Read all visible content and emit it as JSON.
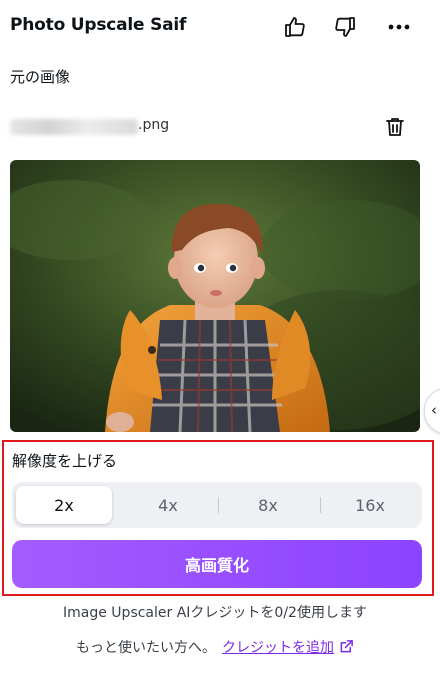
{
  "header": {
    "title": "Photo Upscale Saif",
    "thumbs_up_icon": "thumbs-up-icon",
    "thumbs_down_icon": "thumbs-down-icon",
    "more_icon": "more-horizontal-icon"
  },
  "original": {
    "label": "元の画像",
    "file_extension": ".png",
    "delete_icon": "trash-icon"
  },
  "upscale": {
    "label": "解像度を上げる",
    "options": [
      "2x",
      "4x",
      "8x",
      "16x"
    ],
    "selected": "2x",
    "button_label": "高画質化"
  },
  "footer": {
    "credit_note": "Image Upscaler AIクレジットを0/2使用します",
    "more_text": "もっと使いたい方へ。",
    "add_credit_link": "クレジットを追加"
  },
  "colors": {
    "accent": "#8c43ff",
    "link": "#7d2ae8",
    "highlight_border": "#e0191c"
  }
}
